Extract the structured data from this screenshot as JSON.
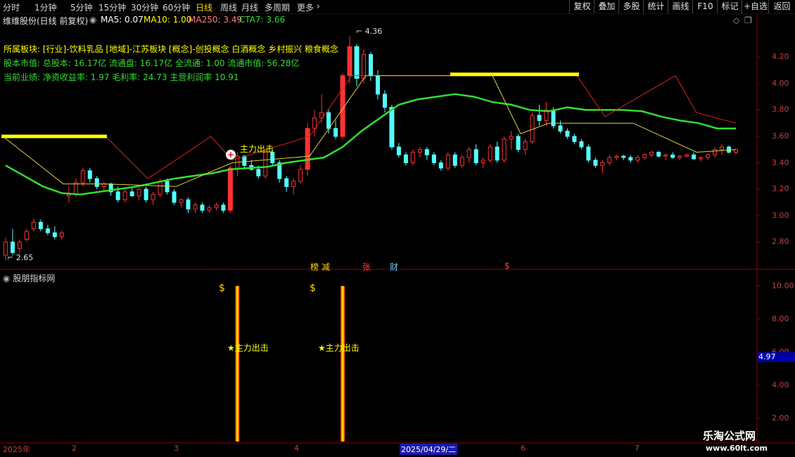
{
  "toolbar": {
    "timeframes": [
      "分时",
      "1分钟",
      "5分钟",
      "15分钟",
      "30分钟",
      "60分钟",
      "日线",
      "周线",
      "月线",
      "多周期",
      "更多"
    ],
    "active_timeframe": "日线",
    "buttons": [
      "复权",
      "叠加",
      "多股",
      "统计",
      "画线",
      "F10",
      "标记",
      "+自选",
      "返回"
    ]
  },
  "stock": {
    "title": "维维股份(日线 前复权)",
    "ma5": "MA5: 0.07",
    "ma10": "MA10: 1.00",
    "ma250": "MA250: 3.49",
    "cta7": "CTA7: 3.66"
  },
  "info": {
    "sector_label": "所属板块:",
    "sector_text": "[行业]-饮料乳品 [地域]-江苏板块 [概念]-创投概念 白酒概念 乡村振兴 粮食概念",
    "capital_label": "股本市值:",
    "capital_text": "总股本: 16.17亿 流通盘: 16.17亿 全流通: 1.00 流通市值: 56.28亿",
    "perf_label": "当前业绩:",
    "perf_text": "净资收益率: 1.97 毛利率: 24.73 主营利润率 10.91"
  },
  "price_axis": [
    "4.20",
    "4.00",
    "3.80",
    "3.60",
    "3.40",
    "3.20",
    "3.00",
    "2.80"
  ],
  "annotations": {
    "high": "4.36",
    "low": "2.65",
    "signal_main": "主力出击",
    "event_tags": [
      "榜",
      "减",
      "张",
      "财",
      "$"
    ]
  },
  "indicator": {
    "title": "股朋指标网",
    "axis": [
      "10.00",
      "8.00",
      "6.00",
      "4.00",
      "2.00"
    ],
    "current_value": "4.97",
    "signal_text": "★主力出击"
  },
  "time_axis": {
    "labels": [
      "2025年",
      "2",
      "3",
      "4",
      "2025/04/29/二",
      "6",
      "7"
    ]
  },
  "watermark": {
    "line1": "乐淘公式网",
    "line2": "www.60lt.com"
  },
  "colors": {
    "up": "#ff3232",
    "down": "#54ffff",
    "ma_green": "#33dd33",
    "ma_yellow": "#ffff00",
    "ma_red": "#dd2222",
    "bar_signal": "#ffd700"
  },
  "chart_data": {
    "type": "candlestick",
    "ylim": [
      2.62,
      4.42
    ],
    "candles": [
      [
        2.7,
        2.83,
        2.66,
        2.8
      ],
      [
        2.8,
        2.9,
        2.7,
        2.72
      ],
      [
        2.75,
        2.82,
        2.72,
        2.8
      ],
      [
        2.82,
        2.9,
        2.8,
        2.88
      ],
      [
        2.9,
        2.98,
        2.88,
        2.95
      ],
      [
        2.95,
        2.97,
        2.88,
        2.9
      ],
      [
        2.9,
        2.93,
        2.85,
        2.87
      ],
      [
        2.87,
        2.92,
        2.82,
        2.84
      ],
      [
        2.84,
        2.89,
        2.82,
        2.87
      ],
      [
        3.15,
        3.22,
        3.1,
        3.16
      ],
      [
        3.16,
        3.28,
        3.14,
        3.25
      ],
      [
        3.25,
        3.36,
        3.22,
        3.34
      ],
      [
        3.34,
        3.36,
        3.25,
        3.28
      ],
      [
        3.28,
        3.3,
        3.2,
        3.22
      ],
      [
        3.22,
        3.26,
        3.18,
        3.24
      ],
      [
        3.24,
        3.25,
        3.15,
        3.18
      ],
      [
        3.18,
        3.22,
        3.1,
        3.12
      ],
      [
        3.12,
        3.2,
        3.1,
        3.18
      ],
      [
        3.18,
        3.22,
        3.14,
        3.15
      ],
      [
        3.15,
        3.21,
        3.12,
        3.2
      ],
      [
        3.2,
        3.22,
        3.1,
        3.12
      ],
      [
        3.12,
        3.18,
        3.08,
        3.16
      ],
      [
        3.16,
        3.28,
        3.14,
        3.26
      ],
      [
        3.26,
        3.28,
        3.16,
        3.18
      ],
      [
        3.18,
        3.2,
        3.08,
        3.1
      ],
      [
        3.1,
        3.13,
        3.06,
        3.12
      ],
      [
        3.12,
        3.14,
        3.02,
        3.05
      ],
      [
        3.05,
        3.1,
        3.02,
        3.08
      ],
      [
        3.08,
        3.1,
        3.02,
        3.04
      ],
      [
        3.04,
        3.08,
        3.02,
        3.06
      ],
      [
        3.06,
        3.1,
        3.04,
        3.08
      ],
      [
        3.08,
        3.1,
        3.02,
        3.04
      ],
      [
        3.04,
        3.38,
        3.02,
        3.36
      ],
      [
        3.36,
        3.48,
        3.3,
        3.45
      ],
      [
        3.45,
        3.46,
        3.36,
        3.38
      ],
      [
        3.38,
        3.42,
        3.34,
        3.35
      ],
      [
        3.35,
        3.38,
        3.28,
        3.3
      ],
      [
        3.3,
        3.5,
        3.28,
        3.48
      ],
      [
        3.48,
        3.5,
        3.38,
        3.4
      ],
      [
        3.4,
        3.42,
        3.25,
        3.28
      ],
      [
        3.28,
        3.3,
        3.18,
        3.22
      ],
      [
        3.22,
        3.28,
        3.16,
        3.26
      ],
      [
        3.26,
        3.38,
        3.24,
        3.35
      ],
      [
        3.35,
        3.7,
        3.3,
        3.66
      ],
      [
        3.66,
        3.8,
        3.6,
        3.74
      ],
      [
        3.74,
        3.92,
        3.7,
        3.78
      ],
      [
        3.78,
        3.8,
        3.62,
        3.66
      ],
      [
        3.66,
        3.72,
        3.58,
        3.6
      ],
      [
        3.6,
        4.08,
        3.58,
        4.06
      ],
      [
        4.06,
        4.36,
        4.0,
        4.28
      ],
      [
        4.28,
        4.3,
        3.98,
        4.04
      ],
      [
        4.04,
        4.26,
        4.0,
        4.22
      ],
      [
        4.22,
        4.24,
        4.02,
        4.06
      ],
      [
        4.06,
        4.1,
        3.88,
        3.92
      ],
      [
        3.92,
        3.95,
        3.78,
        3.82
      ],
      [
        3.82,
        3.84,
        3.5,
        3.52
      ],
      [
        3.52,
        3.55,
        3.44,
        3.46
      ],
      [
        3.46,
        3.48,
        3.38,
        3.4
      ],
      [
        3.4,
        3.5,
        3.38,
        3.48
      ],
      [
        3.48,
        3.52,
        3.44,
        3.5
      ],
      [
        3.5,
        3.52,
        3.42,
        3.46
      ],
      [
        3.46,
        3.48,
        3.38,
        3.4
      ],
      [
        3.4,
        3.42,
        3.34,
        3.36
      ],
      [
        3.36,
        3.48,
        3.34,
        3.46
      ],
      [
        3.46,
        3.48,
        3.36,
        3.38
      ],
      [
        3.38,
        3.46,
        3.36,
        3.44
      ],
      [
        3.44,
        3.52,
        3.4,
        3.5
      ],
      [
        3.5,
        3.54,
        3.38,
        3.4
      ],
      [
        3.4,
        3.44,
        3.36,
        3.42
      ],
      [
        3.42,
        3.54,
        3.4,
        3.52
      ],
      [
        3.52,
        3.56,
        3.4,
        3.42
      ],
      [
        3.42,
        3.6,
        3.4,
        3.58
      ],
      [
        3.58,
        3.64,
        3.5,
        3.6
      ],
      [
        3.6,
        3.62,
        3.48,
        3.5
      ],
      [
        3.5,
        3.58,
        3.46,
        3.56
      ],
      [
        3.56,
        3.78,
        3.54,
        3.76
      ],
      [
        3.76,
        3.84,
        3.68,
        3.72
      ],
      [
        3.72,
        3.86,
        3.68,
        3.8
      ],
      [
        3.8,
        3.82,
        3.66,
        3.68
      ],
      [
        3.68,
        3.72,
        3.62,
        3.64
      ],
      [
        3.64,
        3.66,
        3.58,
        3.6
      ],
      [
        3.6,
        3.62,
        3.54,
        3.56
      ],
      [
        3.56,
        3.58,
        3.5,
        3.52
      ],
      [
        3.52,
        3.54,
        3.4,
        3.42
      ],
      [
        3.42,
        3.44,
        3.36,
        3.38
      ],
      [
        3.38,
        3.42,
        3.32,
        3.4
      ],
      [
        3.4,
        3.46,
        3.38,
        3.44
      ],
      [
        3.44,
        3.46,
        3.42,
        3.45
      ],
      [
        3.45,
        3.46,
        3.42,
        3.44
      ],
      [
        3.44,
        3.46,
        3.4,
        3.42
      ],
      [
        3.42,
        3.46,
        3.4,
        3.44
      ],
      [
        3.44,
        3.47,
        3.42,
        3.46
      ],
      [
        3.46,
        3.49,
        3.44,
        3.48
      ],
      [
        3.48,
        3.49,
        3.44,
        3.45
      ],
      [
        3.45,
        3.47,
        3.42,
        3.46
      ],
      [
        3.46,
        3.48,
        3.43,
        3.44
      ],
      [
        3.44,
        3.46,
        3.42,
        3.45
      ],
      [
        3.45,
        3.47,
        3.44,
        3.46
      ],
      [
        3.46,
        3.48,
        3.42,
        3.43
      ],
      [
        3.43,
        3.45,
        3.41,
        3.44
      ],
      [
        3.44,
        3.47,
        3.42,
        3.46
      ],
      [
        3.46,
        3.52,
        3.44,
        3.5
      ],
      [
        3.5,
        3.54,
        3.46,
        3.52
      ],
      [
        3.52,
        3.53,
        3.47,
        3.48
      ],
      [
        3.48,
        3.51,
        3.46,
        3.5
      ]
    ],
    "ma_green": [
      3.38,
      3.3,
      3.22,
      3.17,
      3.16,
      3.18,
      3.2,
      3.22,
      3.25,
      3.28,
      3.3,
      3.32,
      3.35,
      3.36,
      3.37,
      3.4,
      3.42,
      3.44,
      3.52,
      3.64,
      3.74,
      3.84,
      3.88,
      3.9,
      3.92,
      3.9,
      3.86,
      3.84,
      3.8,
      3.79,
      3.82,
      3.8,
      3.8,
      3.8,
      3.79,
      3.75,
      3.72,
      3.7,
      3.66,
      3.66
    ],
    "indicator_bars": [
      33,
      48
    ],
    "indicator_value": 4.97
  }
}
